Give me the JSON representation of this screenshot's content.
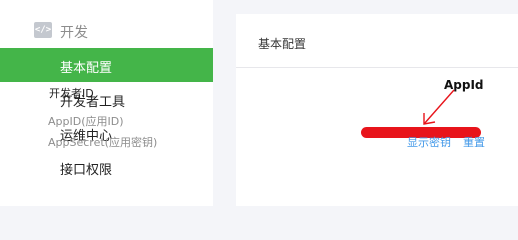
{
  "sidebar": {
    "section_icon_glyph": "</>",
    "section_label": "开发",
    "items": [
      {
        "label": "基本配置",
        "active": true
      },
      {
        "label": "开发者工具",
        "active": false
      },
      {
        "label": "运维中心",
        "active": false
      },
      {
        "label": "接口权限",
        "active": false
      }
    ]
  },
  "panel": {
    "title": "基本配置",
    "section_title": "开发者ID",
    "appid_label": "AppID(应用ID)",
    "secret_label": "AppSecret(应用密钥)",
    "show_secret_link": "显示密钥",
    "reset_link": "重置"
  },
  "annotation": {
    "label": "AppId",
    "color": "#e8141b"
  },
  "colors": {
    "accent": "#44b549",
    "link": "#459ae9",
    "redaction": "#e8141b"
  }
}
